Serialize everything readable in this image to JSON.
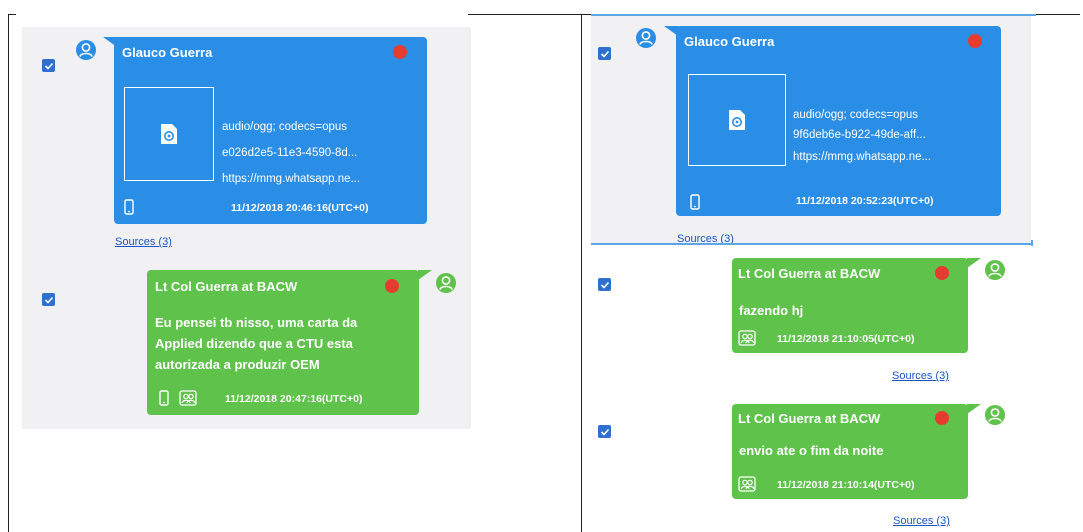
{
  "left_panel": {
    "msg1": {
      "sender": "Glauco Guerra",
      "attachment": [
        "audio/ogg; codecs=opus",
        "e026d2e5-11e3-4590-8d...",
        "https://mmg.whatsapp.ne..."
      ],
      "timestamp": "11/12/2018 20:46:16(UTC+0)",
      "sources": "Sources (3)"
    },
    "msg2": {
      "sender": "Lt Col Guerra at BACW",
      "text_lines": [
        "Eu pensei tb nisso, uma carta da",
        "Applied dizendo que a CTU esta",
        "autorizada a produzir OEM"
      ],
      "timestamp": "11/12/2018 20:47:16(UTC+0)"
    }
  },
  "right_panel": {
    "msg1": {
      "sender": "Glauco Guerra",
      "attachment": [
        "audio/ogg; codecs=opus",
        "9f6deb6e-b922-49de-aff...",
        "https://mmg.whatsapp.ne..."
      ],
      "timestamp": "11/12/2018 20:52:23(UTC+0)",
      "sources": "Sources (3)"
    },
    "msg2": {
      "sender": "Lt Col Guerra at BACW",
      "text": "fazendo hj",
      "timestamp": "11/12/2018 21:10:05(UTC+0)",
      "sources": "Sources (3)"
    },
    "msg3": {
      "sender": "Lt Col Guerra at BACW",
      "text": "envio ate o fim da noite",
      "timestamp": "11/12/2018 21:10:14(UTC+0)",
      "sources": "Sources (3)"
    }
  },
  "colors": {
    "blue_bubble": "#2b8ee6",
    "green_bubble": "#5fc24b",
    "status_dot": "#e53c2f",
    "checkbox": "#2f6fd0",
    "link": "#1a55c4"
  },
  "icons": [
    "checkbox-checked-icon",
    "user-avatar-icon",
    "audio-file-icon",
    "phone-icon",
    "contacts-icon",
    "status-dot"
  ]
}
